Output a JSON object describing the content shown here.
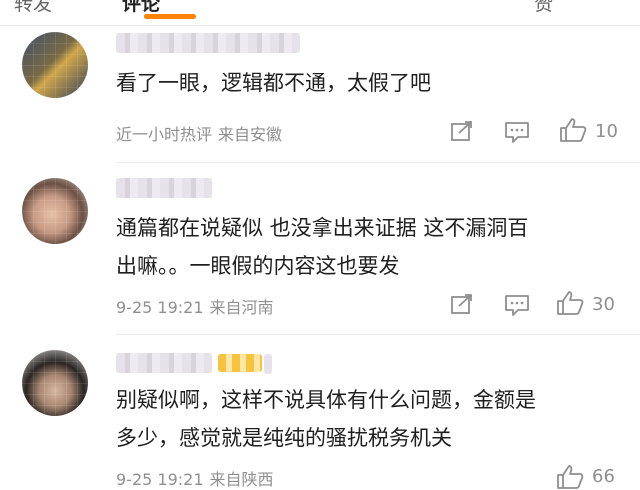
{
  "tabs": {
    "active": "评论"
  },
  "comments": [
    {
      "text_lines": [
        "看了一眼，逻辑都不通，太假了吧"
      ],
      "time": "近一小时热评",
      "location": "来自安徽",
      "likes": "10",
      "avatar_icon": "avatar-icon",
      "colors": {
        "accent": "#ff8200"
      }
    },
    {
      "text_lines": [
        "通篇都在说疑似 也没拿出来证据 这不漏洞百",
        "出嘛。。一眼假的内容这也要发"
      ],
      "time": "9-25 19:21",
      "location": "来自河南",
      "likes": "30",
      "avatar_icon": "avatar-icon"
    },
    {
      "text_lines": [
        "别疑似啊，这样不说具体有什么问题，金额是",
        "多少，感觉就是纯纯的骚扰税务机关"
      ],
      "time": "9-25 19:21",
      "location": "来自陕西",
      "likes": "66",
      "avatar_icon": "avatar-icon"
    }
  ],
  "icons": {
    "share": "share-icon",
    "reply": "comment-icon",
    "like": "thumbs-up-icon"
  }
}
